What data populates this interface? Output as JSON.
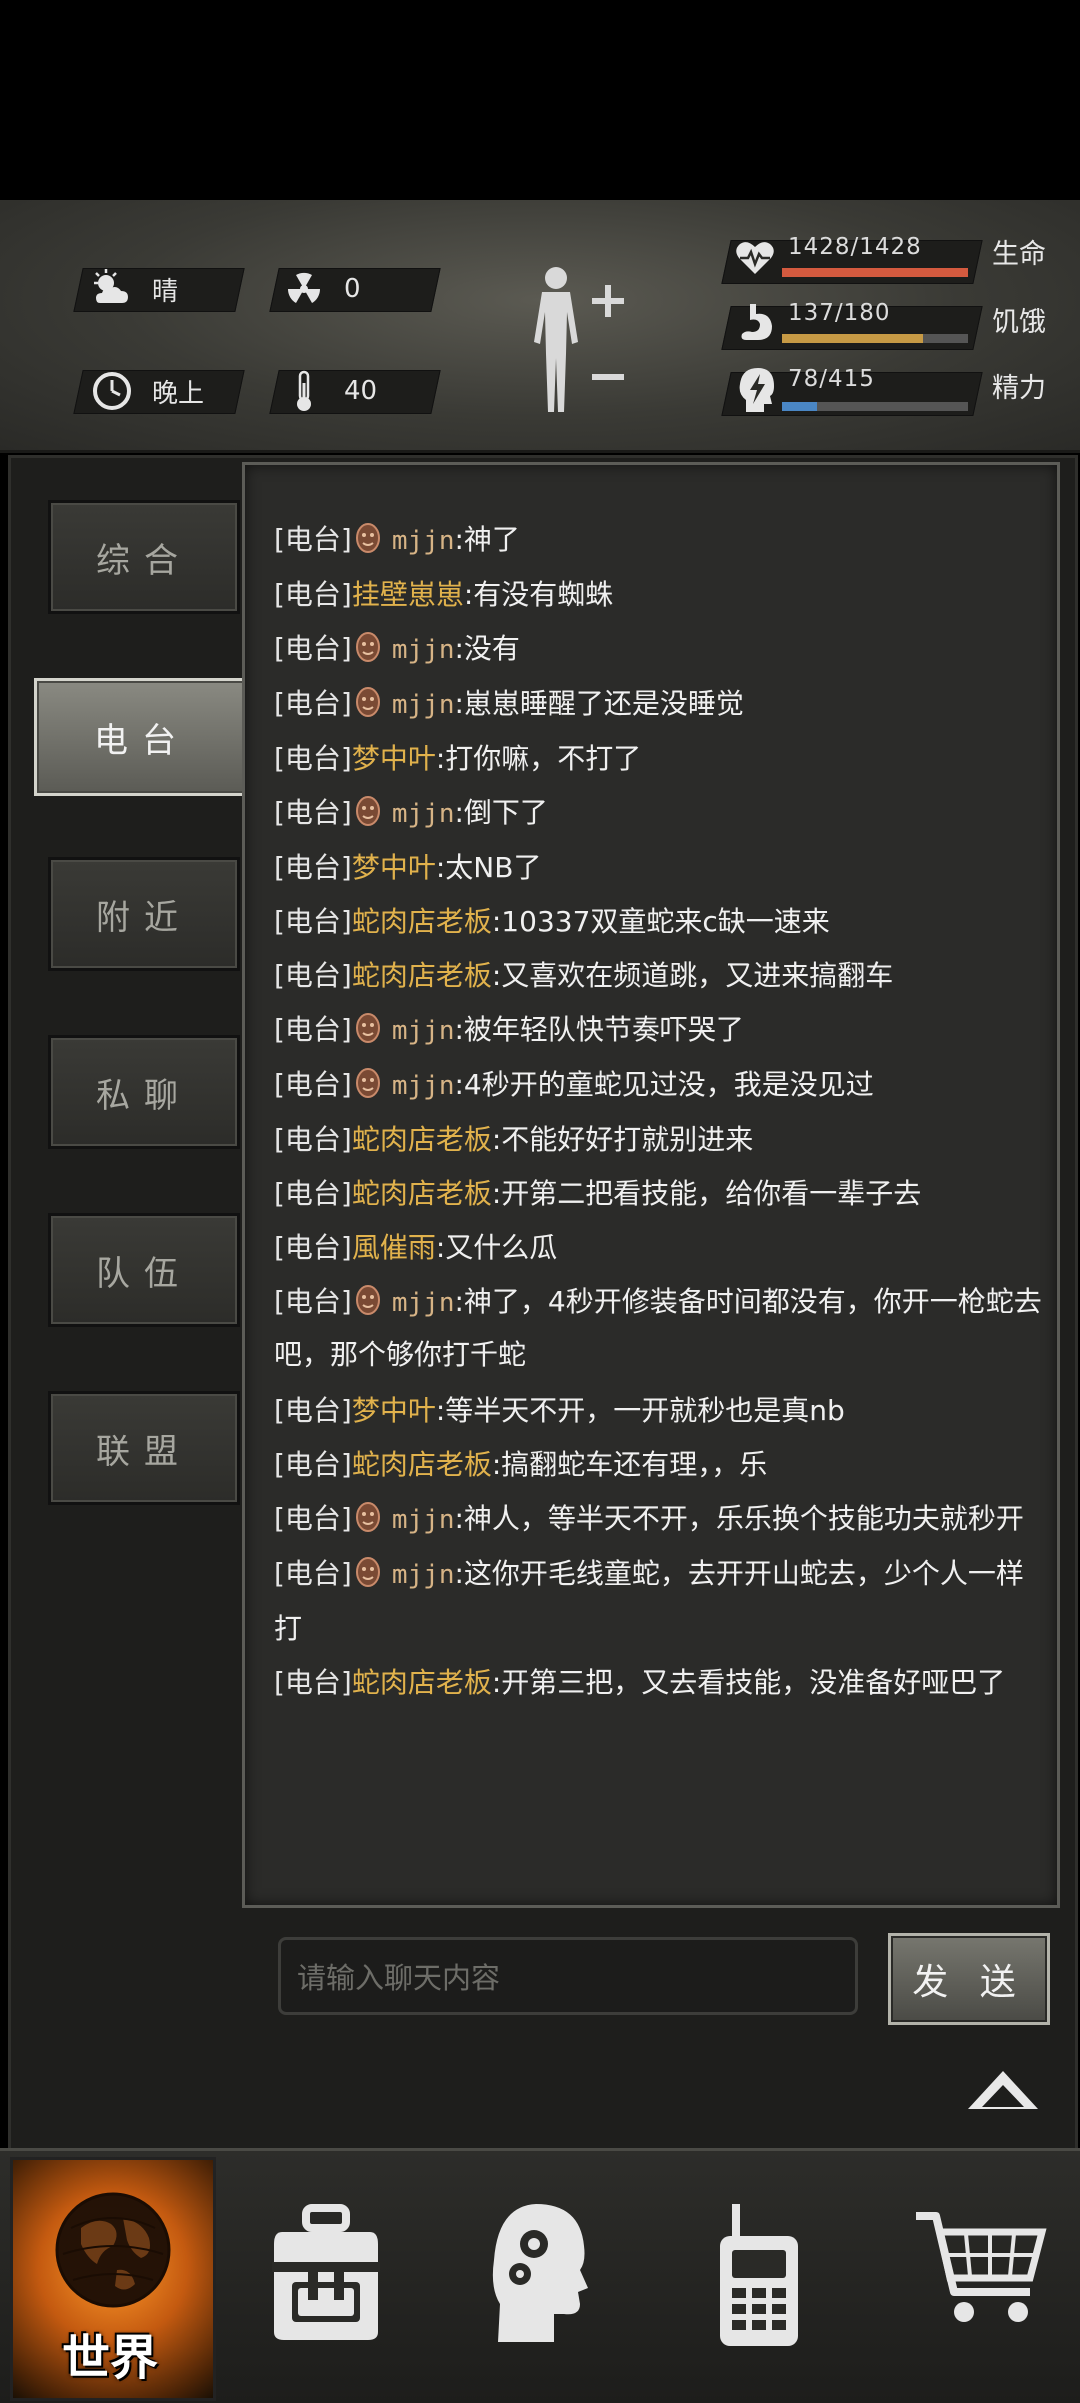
{
  "hud": {
    "weather": "晴",
    "radiation": "0",
    "time_of_day": "晚上",
    "temperature": "40",
    "stats": [
      {
        "label": "生命",
        "value": "1428/1428",
        "fill": 1.0,
        "color": "#d45a3f"
      },
      {
        "label": "饥饿",
        "value": "137/180",
        "fill": 0.76,
        "color": "#c79a45"
      },
      {
        "label": "精力",
        "value": "78/415",
        "fill": 0.19,
        "color": "#4a86c4"
      }
    ],
    "icons": {
      "weather": "sun-cloud-icon",
      "radiation": "radiation-icon",
      "time": "clock-icon",
      "temperature": "thermometer-icon",
      "body": "body-silhouette-icon",
      "health": "heart-pulse-icon",
      "hunger": "stomach-icon",
      "energy": "energy-head-icon"
    }
  },
  "tabs": [
    {
      "label": "综合",
      "active": false
    },
    {
      "label": "电台",
      "active": true
    },
    {
      "label": "附近",
      "active": false
    },
    {
      "label": "私聊",
      "active": false
    },
    {
      "label": "队伍",
      "active": false
    },
    {
      "label": "联盟",
      "active": false
    }
  ],
  "chat": {
    "messages": [
      {
        "channel": "[电台]",
        "avatar": true,
        "name": "mjjn",
        "text": ":神了"
      },
      {
        "channel": "[电台]",
        "avatar": false,
        "name": "挂壁崽崽",
        "text": ":有没有蜘蛛"
      },
      {
        "channel": "[电台]",
        "avatar": true,
        "name": "mjjn",
        "text": ":没有"
      },
      {
        "channel": "[电台]",
        "avatar": true,
        "name": "mjjn",
        "text": ":崽崽睡醒了还是没睡觉"
      },
      {
        "channel": "[电台]",
        "avatar": false,
        "name": "梦中叶",
        "text": ":打你嘛，不打了"
      },
      {
        "channel": "[电台]",
        "avatar": true,
        "name": "mjjn",
        "text": ":倒下了"
      },
      {
        "channel": "[电台]",
        "avatar": false,
        "name": "梦中叶",
        "text": ":太NB了"
      },
      {
        "channel": "[电台]",
        "avatar": false,
        "name": "蛇肉店老板",
        "text": ":10337双童蛇来c缺一速来"
      },
      {
        "channel": "[电台]",
        "avatar": false,
        "name": "蛇肉店老板",
        "text": ":又喜欢在频道跳，又进来搞翻车"
      },
      {
        "channel": "[电台]",
        "avatar": true,
        "name": "mjjn",
        "text": ":被年轻队快节奏吓哭了"
      },
      {
        "channel": "[电台]",
        "avatar": true,
        "name": "mjjn",
        "text": ":4秒开的童蛇见过没，我是没见过"
      },
      {
        "channel": "[电台]",
        "avatar": false,
        "name": "蛇肉店老板",
        "text": ":不能好好打就别进来"
      },
      {
        "channel": "[电台]",
        "avatar": false,
        "name": "蛇肉店老板",
        "text": ":开第二把看技能，给你看一辈子去"
      },
      {
        "channel": "[电台]",
        "avatar": false,
        "name": "風催雨",
        "text": ":又什么瓜"
      },
      {
        "channel": "[电台]",
        "avatar": true,
        "name": "mjjn",
        "text": ":神了，4秒开修装备时间都没有，你开一枪蛇去吧，那个够你打千蛇"
      },
      {
        "channel": "[电台]",
        "avatar": false,
        "name": "梦中叶",
        "text": ":等半天不开，一开就秒也是真nb"
      },
      {
        "channel": "[电台]",
        "avatar": false,
        "name": "蛇肉店老板",
        "text": ":搞翻蛇车还有理，，乐"
      },
      {
        "channel": "[电台]",
        "avatar": true,
        "name": "mjjn",
        "text": ":神人，等半天不开，乐乐换个技能功夫就秒开"
      },
      {
        "channel": "[电台]",
        "avatar": true,
        "name": "mjjn",
        "text": ":这你开毛线童蛇，去开开山蛇去，少个人一样打"
      },
      {
        "channel": "[电台]",
        "avatar": false,
        "name": "蛇肉店老板",
        "text": ":开第三把，又去看技能，没准备好哑巴了"
      }
    ],
    "input_placeholder": "请输入聊天内容",
    "send_label": "发 送",
    "collapse_icon": "chevron-up-icon"
  },
  "bottom_nav": [
    {
      "label": "世界",
      "icon": "globe-icon",
      "active": true
    },
    {
      "label": "",
      "icon": "backpack-icon",
      "active": false
    },
    {
      "label": "",
      "icon": "head-gears-icon",
      "active": false
    },
    {
      "label": "",
      "icon": "walkie-talkie-icon",
      "active": false
    },
    {
      "label": "",
      "icon": "shopping-cart-icon",
      "active": false
    }
  ]
}
